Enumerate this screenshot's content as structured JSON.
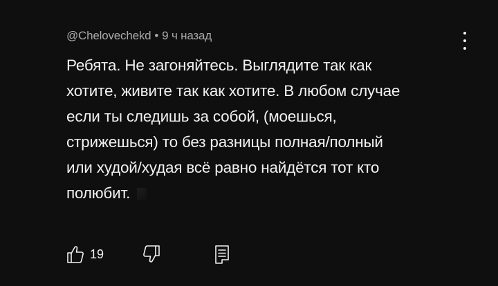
{
  "comment": {
    "author": "@Chelovechekd",
    "separator": "•",
    "time": "9 ч назад",
    "lines": [
      "Ребята. Не загоняйтесь. Выглядите так как",
      "хотите, живите так как хотите. В любом случае",
      "если ты следишь за собой, (моешься,",
      "стрижешься) то без разницы полная/полный",
      "или худой/худая всё равно найдётся тот кто",
      "полюбит."
    ]
  },
  "actions": {
    "like_count": "19",
    "like_icon": "thumbs-up-icon",
    "dislike_icon": "thumbs-down-icon",
    "reply_icon": "reply-icon"
  },
  "menu": {
    "icon": "more-vertical-icon"
  },
  "colors": {
    "background": "#0f0f0f",
    "text": "#f1f1f1",
    "meta": "#aaaaaa"
  }
}
